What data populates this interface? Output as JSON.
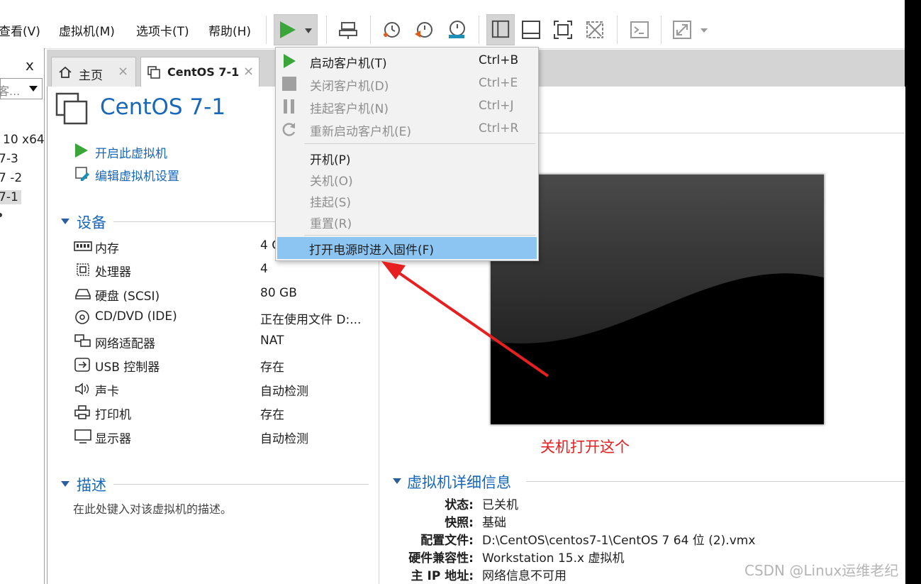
{
  "menubar": {
    "items": [
      "查看(V)",
      "虚拟机(M)",
      "选项卡(T)",
      "帮助(H)"
    ]
  },
  "library": {
    "close": "x",
    "search_placeholder": "客...",
    "items": [
      "10 x64",
      "7-3",
      "7 -2",
      "7-1"
    ]
  },
  "tabs": [
    {
      "label": "主页",
      "close": "×"
    },
    {
      "label": "CentOS 7-1",
      "close": "×"
    }
  ],
  "vm": {
    "title": "CentOS 7-1",
    "actions": [
      "开启此虚拟机",
      "编辑虚拟机设置"
    ]
  },
  "devices": {
    "heading": "设备",
    "rows": [
      {
        "name": "内存",
        "value": "4 G",
        "icon": "memory-icon"
      },
      {
        "name": "处理器",
        "value": "4",
        "icon": "cpu-icon"
      },
      {
        "name": "硬盘 (SCSI)",
        "value": "80 GB",
        "icon": "hdd-icon"
      },
      {
        "name": "CD/DVD (IDE)",
        "value": "正在使用文件 D:...",
        "icon": "cd-icon"
      },
      {
        "name": "网络适配器",
        "value": "NAT",
        "icon": "network-icon"
      },
      {
        "name": "USB 控制器",
        "value": "存在",
        "icon": "usb-icon"
      },
      {
        "name": "声卡",
        "value": "自动检测",
        "icon": "sound-icon"
      },
      {
        "name": "打印机",
        "value": "存在",
        "icon": "printer-icon"
      },
      {
        "name": "显示器",
        "value": "自动检测",
        "icon": "monitor-icon"
      }
    ]
  },
  "description": {
    "heading": "描述",
    "placeholder": "在此处键入对该虚拟机的描述。"
  },
  "annotation": "关机打开这个",
  "details": {
    "heading": "虚拟机详细信息",
    "rows": [
      {
        "label": "状态:",
        "value": "已关机"
      },
      {
        "label": "快照:",
        "value": "基础"
      },
      {
        "label": "配置文件:",
        "value": "D:\\CentOS\\centos7-1\\CentOS 7 64 位 (2).vmx"
      },
      {
        "label": "硬件兼容性:",
        "value": "Workstation 15.x 虚拟机"
      },
      {
        "label": "主 IP 地址:",
        "value": "网络信息不可用"
      }
    ]
  },
  "power_menu": {
    "items": [
      {
        "label": "启动客户机(T)",
        "shortcut": "Ctrl+B",
        "enabled": true
      },
      {
        "label": "关闭客户机(D)",
        "shortcut": "Ctrl+E",
        "enabled": false
      },
      {
        "label": "挂起客户机(N)",
        "shortcut": "Ctrl+J",
        "enabled": false
      },
      {
        "label": "重新启动客户机(E)",
        "shortcut": "Ctrl+R",
        "enabled": false
      },
      {
        "label": "开机(P)",
        "shortcut": "",
        "enabled": true
      },
      {
        "label": "关机(O)",
        "shortcut": "",
        "enabled": false
      },
      {
        "label": "挂起(S)",
        "shortcut": "",
        "enabled": false
      },
      {
        "label": "重置(R)",
        "shortcut": "",
        "enabled": false
      },
      {
        "label": "打开电源时进入固件(F)",
        "shortcut": "",
        "enabled": true,
        "highlighted": true
      }
    ]
  },
  "watermark": "CSDN @Linux运维老纪",
  "colors": {
    "accent": "#1867b8",
    "play_green": "#3aa63a",
    "highlight": "#8cc4f2",
    "annotation_red": "#e62020"
  }
}
